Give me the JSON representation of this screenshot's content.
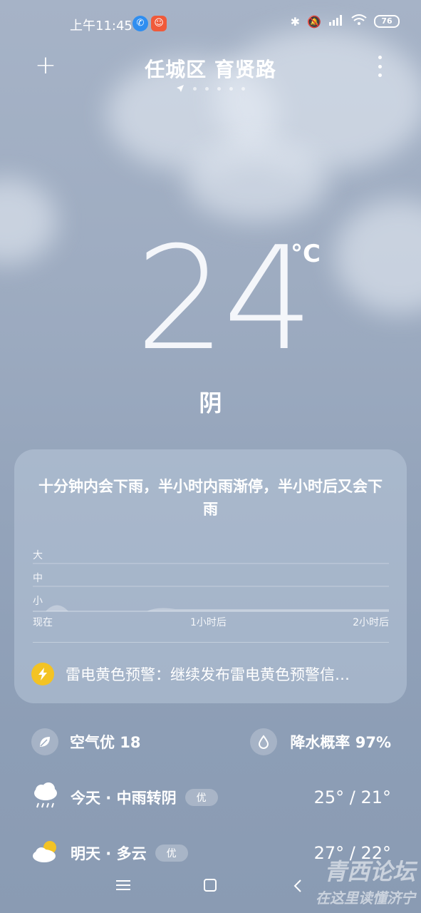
{
  "status_bar": {
    "time": "上午11:45",
    "battery": "76"
  },
  "header": {
    "location": "任城区 育贤路",
    "pages": 6
  },
  "current": {
    "temperature": "24",
    "unit": "°C",
    "condition": "阴"
  },
  "rain_card": {
    "summary": "十分钟内会下雨，半小时内雨渐停，半小时后又会下雨",
    "levels": [
      "大",
      "中",
      "小"
    ],
    "time_labels": [
      "现在",
      "1小时后",
      "2小时后"
    ],
    "alert": "雷电黄色预警：继续发布雷电黄色预警信…"
  },
  "metrics": {
    "air_quality": "空气优 18",
    "precip_prob": "降水概率 97%"
  },
  "forecast": [
    {
      "day": "今天 · 中雨转阴",
      "aqi": "优",
      "temps": "25° / 21°",
      "icon": "rain-cloud-icon"
    },
    {
      "day": "明天 · 多云",
      "aqi": "优",
      "temps": "27° / 22°",
      "icon": "partly-cloudy-icon"
    }
  ],
  "watermark": {
    "line1": "青西论坛",
    "line2": "在这里读懂济宁"
  },
  "colors": {
    "background": "#97a7bd",
    "alert_yellow": "#f3c324"
  }
}
